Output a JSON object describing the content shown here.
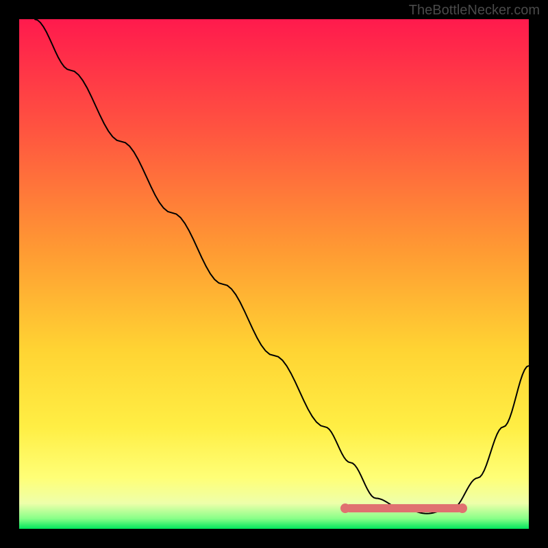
{
  "watermark": "TheBottleNecker.com",
  "chart_data": {
    "type": "line",
    "title": "",
    "xlabel": "",
    "ylabel": "",
    "xlim": [
      0,
      100
    ],
    "ylim": [
      0,
      100
    ],
    "gradient_colors": {
      "top": "#ff1a4d",
      "mid_upper": "#ff9933",
      "mid": "#ffe633",
      "mid_lower": "#ffff66",
      "bottom": "#00e65c"
    },
    "series": [
      {
        "name": "bottleneck-curve",
        "x": [
          3,
          10,
          20,
          30,
          40,
          50,
          60,
          65,
          70,
          75,
          80,
          85,
          90,
          95,
          100
        ],
        "y": [
          100,
          90,
          76,
          62,
          48,
          34,
          20,
          13,
          6,
          4,
          3,
          4,
          10,
          20,
          32
        ]
      }
    ],
    "optimal_range": {
      "x_start": 64,
      "x_end": 87,
      "y": 4
    }
  }
}
